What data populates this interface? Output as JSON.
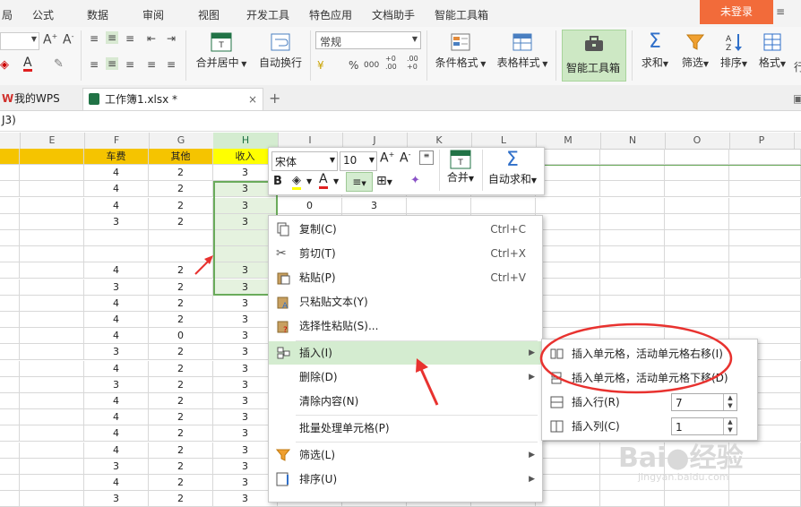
{
  "menubar": {
    "items": [
      "局",
      "公式",
      "数据",
      "审阅",
      "视图",
      "开发工具",
      "特色应用",
      "文档助手",
      "智能工具箱"
    ],
    "login_label": "未登录"
  },
  "ribbon": {
    "merge_label": "合并居中",
    "wrap_label": "自动换行",
    "number_format": "常规",
    "cond_format_label": "条件格式",
    "table_style_label": "表格样式",
    "smart_toolbox_label": "智能工具箱",
    "sum_label": "求和",
    "filter_label": "筛选",
    "sort_label": "排序",
    "format_label": "格式",
    "percent": "%",
    "thousands": "000",
    "dec_inc": "+0 .00",
    "dec_dec": ".00 +0"
  },
  "tabs": {
    "wps_label": "我的WPS",
    "file_label": "工作簿1.xlsx *",
    "close": "×",
    "add": "+"
  },
  "formula_bar": {
    "ref": "J3)"
  },
  "grid": {
    "col_headers": [
      "E",
      "F",
      "G",
      "H",
      "I",
      "J",
      "K",
      "L",
      "M",
      "N",
      "O",
      "P"
    ],
    "header_row": {
      "F": "车费",
      "G": "其他",
      "H": "收入"
    },
    "rows": [
      {
        "F": "4",
        "G": "2",
        "H": "3"
      },
      {
        "F": "4",
        "G": "2",
        "H": "3"
      },
      {
        "F": "4",
        "G": "2",
        "H": "3",
        "I": "0",
        "J": "3"
      },
      {
        "F": "3",
        "G": "2",
        "H": "3"
      },
      {
        "F": "",
        "G": "",
        "H": ""
      },
      {
        "F": "",
        "G": "",
        "H": ""
      },
      {
        "F": "4",
        "G": "2",
        "H": "3"
      },
      {
        "F": "3",
        "G": "2",
        "H": "3"
      },
      {
        "F": "4",
        "G": "2",
        "H": "3"
      },
      {
        "F": "4",
        "G": "2",
        "H": "3"
      },
      {
        "F": "4",
        "G": "0",
        "H": "3"
      },
      {
        "F": "3",
        "G": "2",
        "H": "3"
      },
      {
        "F": "4",
        "G": "2",
        "H": "3"
      },
      {
        "F": "3",
        "G": "2",
        "H": "3"
      },
      {
        "F": "4",
        "G": "2",
        "H": "3"
      },
      {
        "F": "4",
        "G": "2",
        "H": "3"
      },
      {
        "F": "4",
        "G": "2",
        "H": "3"
      },
      {
        "F": "4",
        "G": "2",
        "H": "3"
      },
      {
        "F": "3",
        "G": "2",
        "H": "3"
      },
      {
        "F": "4",
        "G": "2",
        "H": "3"
      },
      {
        "F": "3",
        "G": "2",
        "H": "3"
      }
    ]
  },
  "mini_toolbar": {
    "font": "宋体",
    "size": "10",
    "bold": "B",
    "merge_label": "合并",
    "autosum_label": "自动求和"
  },
  "context_menu": {
    "items": [
      {
        "label": "复制(C)",
        "shortcut": "Ctrl+C"
      },
      {
        "label": "剪切(T)",
        "shortcut": "Ctrl+X"
      },
      {
        "label": "粘贴(P)",
        "shortcut": "Ctrl+V"
      },
      {
        "label": "只粘贴文本(Y)",
        "shortcut": ""
      },
      {
        "label": "选择性粘贴(S)...",
        "shortcut": ""
      },
      {
        "label": "插入(I)",
        "shortcut": ""
      },
      {
        "label": "删除(D)",
        "shortcut": ""
      },
      {
        "label": "清除内容(N)",
        "shortcut": ""
      },
      {
        "label": "批量处理单元格(P)",
        "shortcut": ""
      },
      {
        "label": "筛选(L)",
        "shortcut": ""
      },
      {
        "label": "排序(U)",
        "shortcut": ""
      }
    ]
  },
  "insert_submenu": {
    "items": [
      {
        "label": "插入单元格，活动单元格右移(I)"
      },
      {
        "label": "插入单元格，活动单元格下移(D)"
      },
      {
        "label": "插入行(R)",
        "value": "7"
      },
      {
        "label": "插入列(C)",
        "value": "1"
      }
    ]
  },
  "colors": {
    "accent_green": "#217346",
    "header_yellow": "#f5c400",
    "highlight_yellow": "#ffff00",
    "login_orange": "#f26b3a",
    "hover_green": "#d4ecd0",
    "annotation_red": "#e8322f"
  }
}
